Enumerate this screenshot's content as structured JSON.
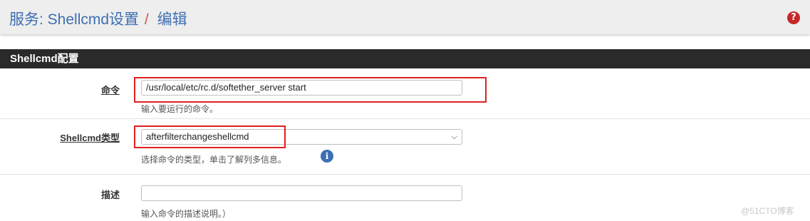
{
  "header": {
    "breadcrumb_section": "服务: Shellcmd设置",
    "breadcrumb_separator": "/",
    "breadcrumb_page": "编辑",
    "help_icon": "question-circle-icon"
  },
  "panel": {
    "title": "Shellcmd配置"
  },
  "fields": {
    "command": {
      "label": "命令",
      "value": "/usr/local/etc/rc.d/softether_server start",
      "help": "输入要运行的命令。"
    },
    "type": {
      "label": "Shellcmd类型",
      "value": "afterfilterchangeshellcmd",
      "help": "选择命令的类型，单击了解列多信息。",
      "info_icon": "info-circle-icon"
    },
    "description": {
      "label": "描述",
      "value": "",
      "help": "输入命令的描述说明。）"
    }
  },
  "watermark": "@51CTO博客",
  "colors": {
    "breadcrumb": "#3e6fb3",
    "separator": "#d9534f",
    "panel_heading_bg": "#2a2a2a",
    "highlight_box": "#e02020",
    "help_icon": "#c62828",
    "info_icon": "#3e6fb3"
  }
}
